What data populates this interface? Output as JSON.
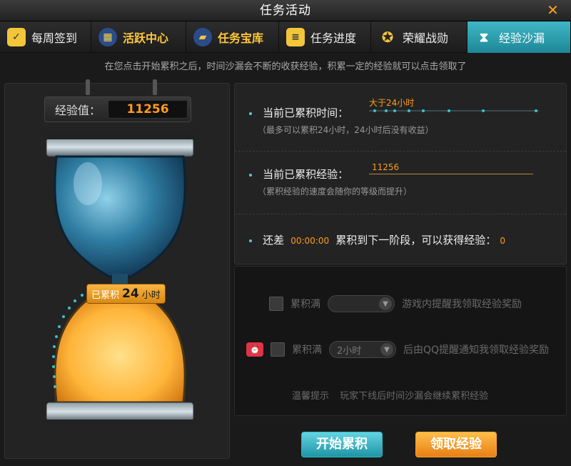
{
  "window": {
    "title": "任务活动",
    "close": "✕"
  },
  "tabs": [
    {
      "label": "每周签到",
      "icon": "calendar-check-icon"
    },
    {
      "label": "活跃中心",
      "icon": "calendar-icon"
    },
    {
      "label": "任务宝库",
      "icon": "folder-icon"
    },
    {
      "label": "任务进度",
      "icon": "progress-icon"
    },
    {
      "label": "荣耀战勋",
      "icon": "medal-icon"
    },
    {
      "label": "经验沙漏",
      "icon": "hourglass-icon",
      "active": true
    }
  ],
  "hint": "在您点击开始累积之后，时间沙漏会不断的收获经验，积累一定的经验就可以点击领取了",
  "exp": {
    "label": "经验值：",
    "value": "11256"
  },
  "badge": {
    "prefix": "已累积",
    "value": "24",
    "unit": "小时"
  },
  "status": {
    "time_label": "当前已累积时间：",
    "time_value": "大于24小时",
    "time_note": "（最多可以累积24小时，24小时后没有收益）",
    "exp_label": "当前已累积经验：",
    "exp_value": "11256",
    "exp_note": "（累积经验的速度会随你的等级而提升）",
    "next_prefix": "还差",
    "next_time": "00:00:00",
    "next_mid": "累积到下一阶段，可以获得经验：",
    "next_exp": "0"
  },
  "options": {
    "row1_prefix": "累积满",
    "row1_select": "",
    "row1_suffix": "游戏内提醒我领取经验奖励",
    "row2_prefix": "累积满",
    "row2_select": "2小时",
    "row2_suffix": "后由QQ提醒通知我领取经验奖励",
    "tip_label": "温馨提示",
    "tip_text": "玩家下线后时间沙漏会继续累积经验"
  },
  "buttons": {
    "start": "开始累积",
    "claim": "领取经验"
  },
  "colors": {
    "accent": "#1fa9b8",
    "orange": "#ff9b1e",
    "sand": "#ffc24a",
    "glass": "#2c6a8a"
  }
}
